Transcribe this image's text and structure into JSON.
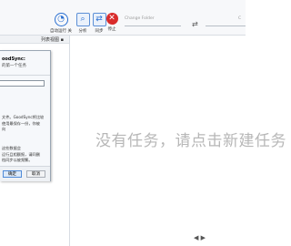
{
  "toolbar": {
    "auto_run_label": "自动运行 关",
    "analyze_label": "分析",
    "sync_label": "同步",
    "stop_label": "停止",
    "change_folder_label": "Change Folder",
    "right_label": "C"
  },
  "left_panel": {
    "list_view_label": "列表视图 ▪"
  },
  "dialog": {
    "title": "oodSync:",
    "subtitle": "的第一个任务",
    "input_value": "",
    "description": "文件。GoodSync将比较\n使用最保存一份，你被\n向",
    "note": "这些数据会\n运行且相额报，请同删\n档同步以被频繁。",
    "ok_label": "确定",
    "cancel_label": "取消"
  },
  "main": {
    "empty_message": "没有任务，请点击新建任务"
  },
  "pager": {
    "text": "◀ ▶"
  },
  "colors": {
    "accent": "#2a6fd1",
    "stop": "#d92b2b",
    "border": "#d8dde3",
    "empty_text": "#b7b7b7"
  }
}
